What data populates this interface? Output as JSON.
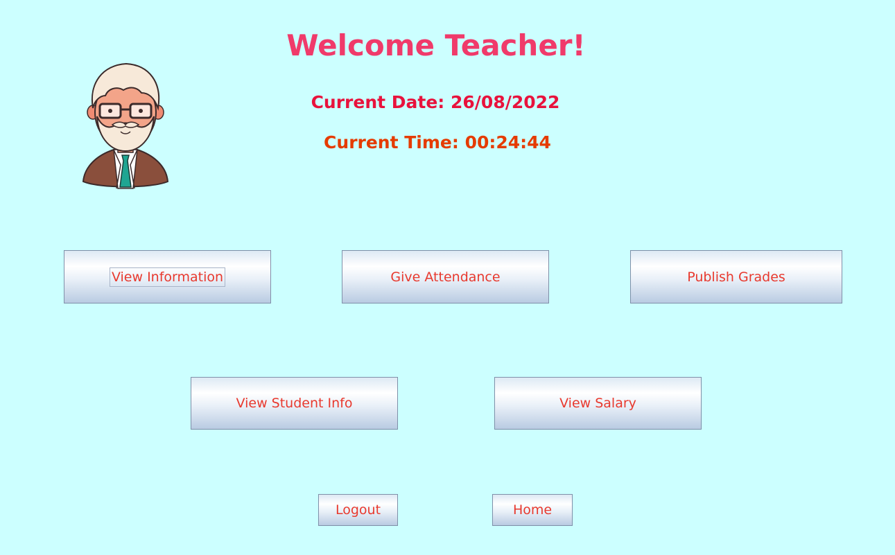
{
  "header": {
    "title": "Welcome Teacher!",
    "date_text": "Current Date: 26/08/2022",
    "time_text": "Current Time: 00:24:44"
  },
  "avatar": {
    "icon": "teacher-avatar-icon"
  },
  "buttons": {
    "view_information": "View Information",
    "give_attendance": "Give Attendance",
    "publish_grades": "Publish Grades",
    "view_student_info": "View Student Info",
    "view_salary": "View Salary",
    "logout": "Logout",
    "home": "Home"
  },
  "colors": {
    "background": "#ccffff",
    "title": "#f03a6a",
    "date": "#e8123c",
    "time": "#e53b00",
    "button_text": "#e8392e"
  }
}
